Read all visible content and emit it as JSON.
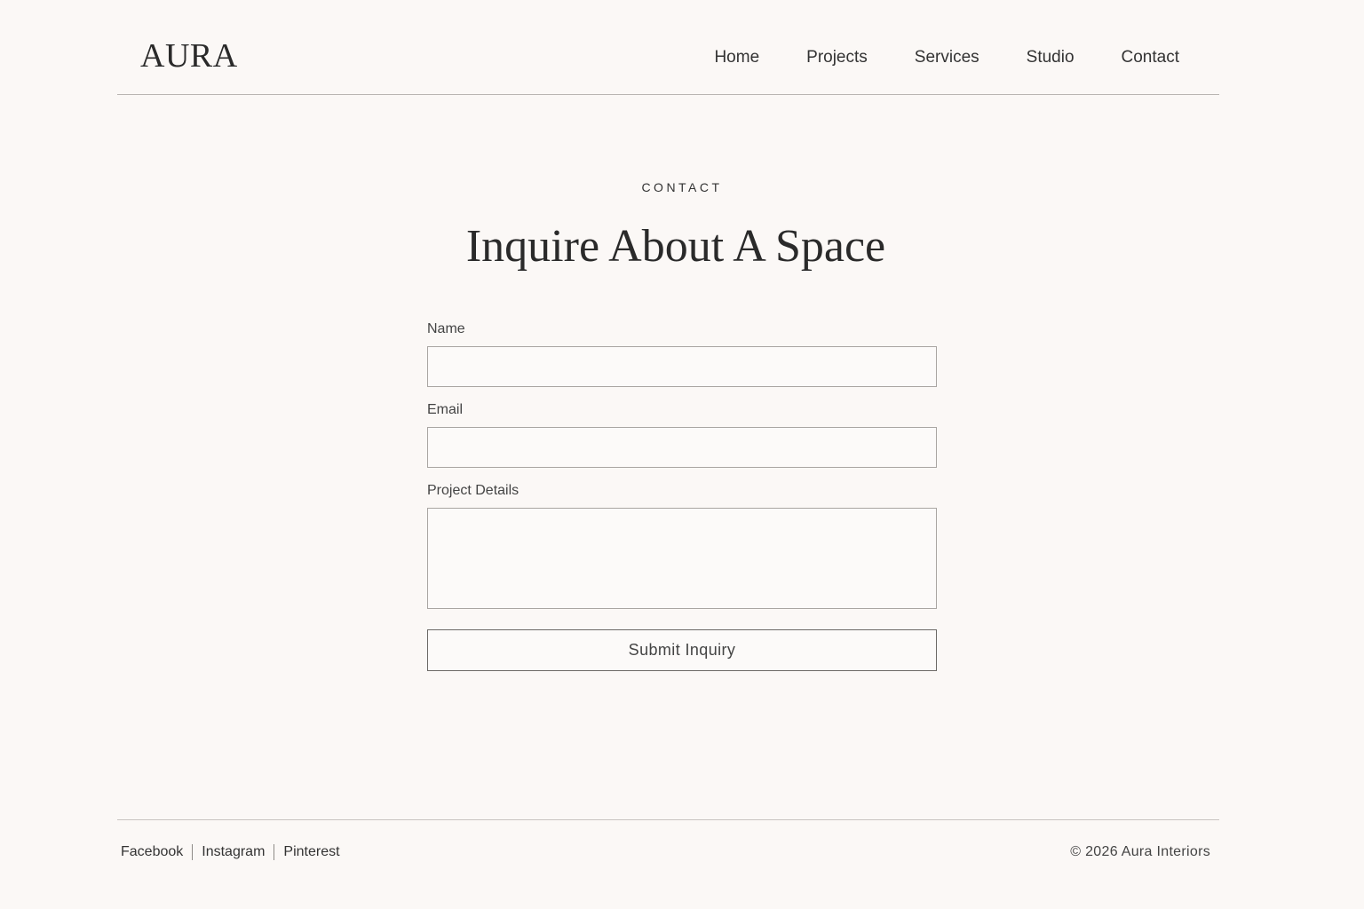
{
  "header": {
    "logo": "AURA",
    "nav": [
      {
        "label": "Home"
      },
      {
        "label": "Projects"
      },
      {
        "label": "Services"
      },
      {
        "label": "Studio"
      },
      {
        "label": "Contact"
      }
    ]
  },
  "hero": {
    "eyebrow": "CONTACT",
    "title": "Inquire About A Space"
  },
  "form": {
    "name": {
      "label": "Name",
      "value": ""
    },
    "email": {
      "label": "Email",
      "value": ""
    },
    "details": {
      "label": "Project Details",
      "value": ""
    },
    "submit_label": "Submit Inquiry"
  },
  "footer": {
    "social": [
      {
        "label": "Facebook"
      },
      {
        "label": "Instagram"
      },
      {
        "label": "Pinterest"
      }
    ],
    "copyright": "© 2026 Aura Interiors"
  },
  "colors": {
    "background": "#fbf8f6",
    "text": "#2b2b2b",
    "border": "#a9a5a2"
  }
}
